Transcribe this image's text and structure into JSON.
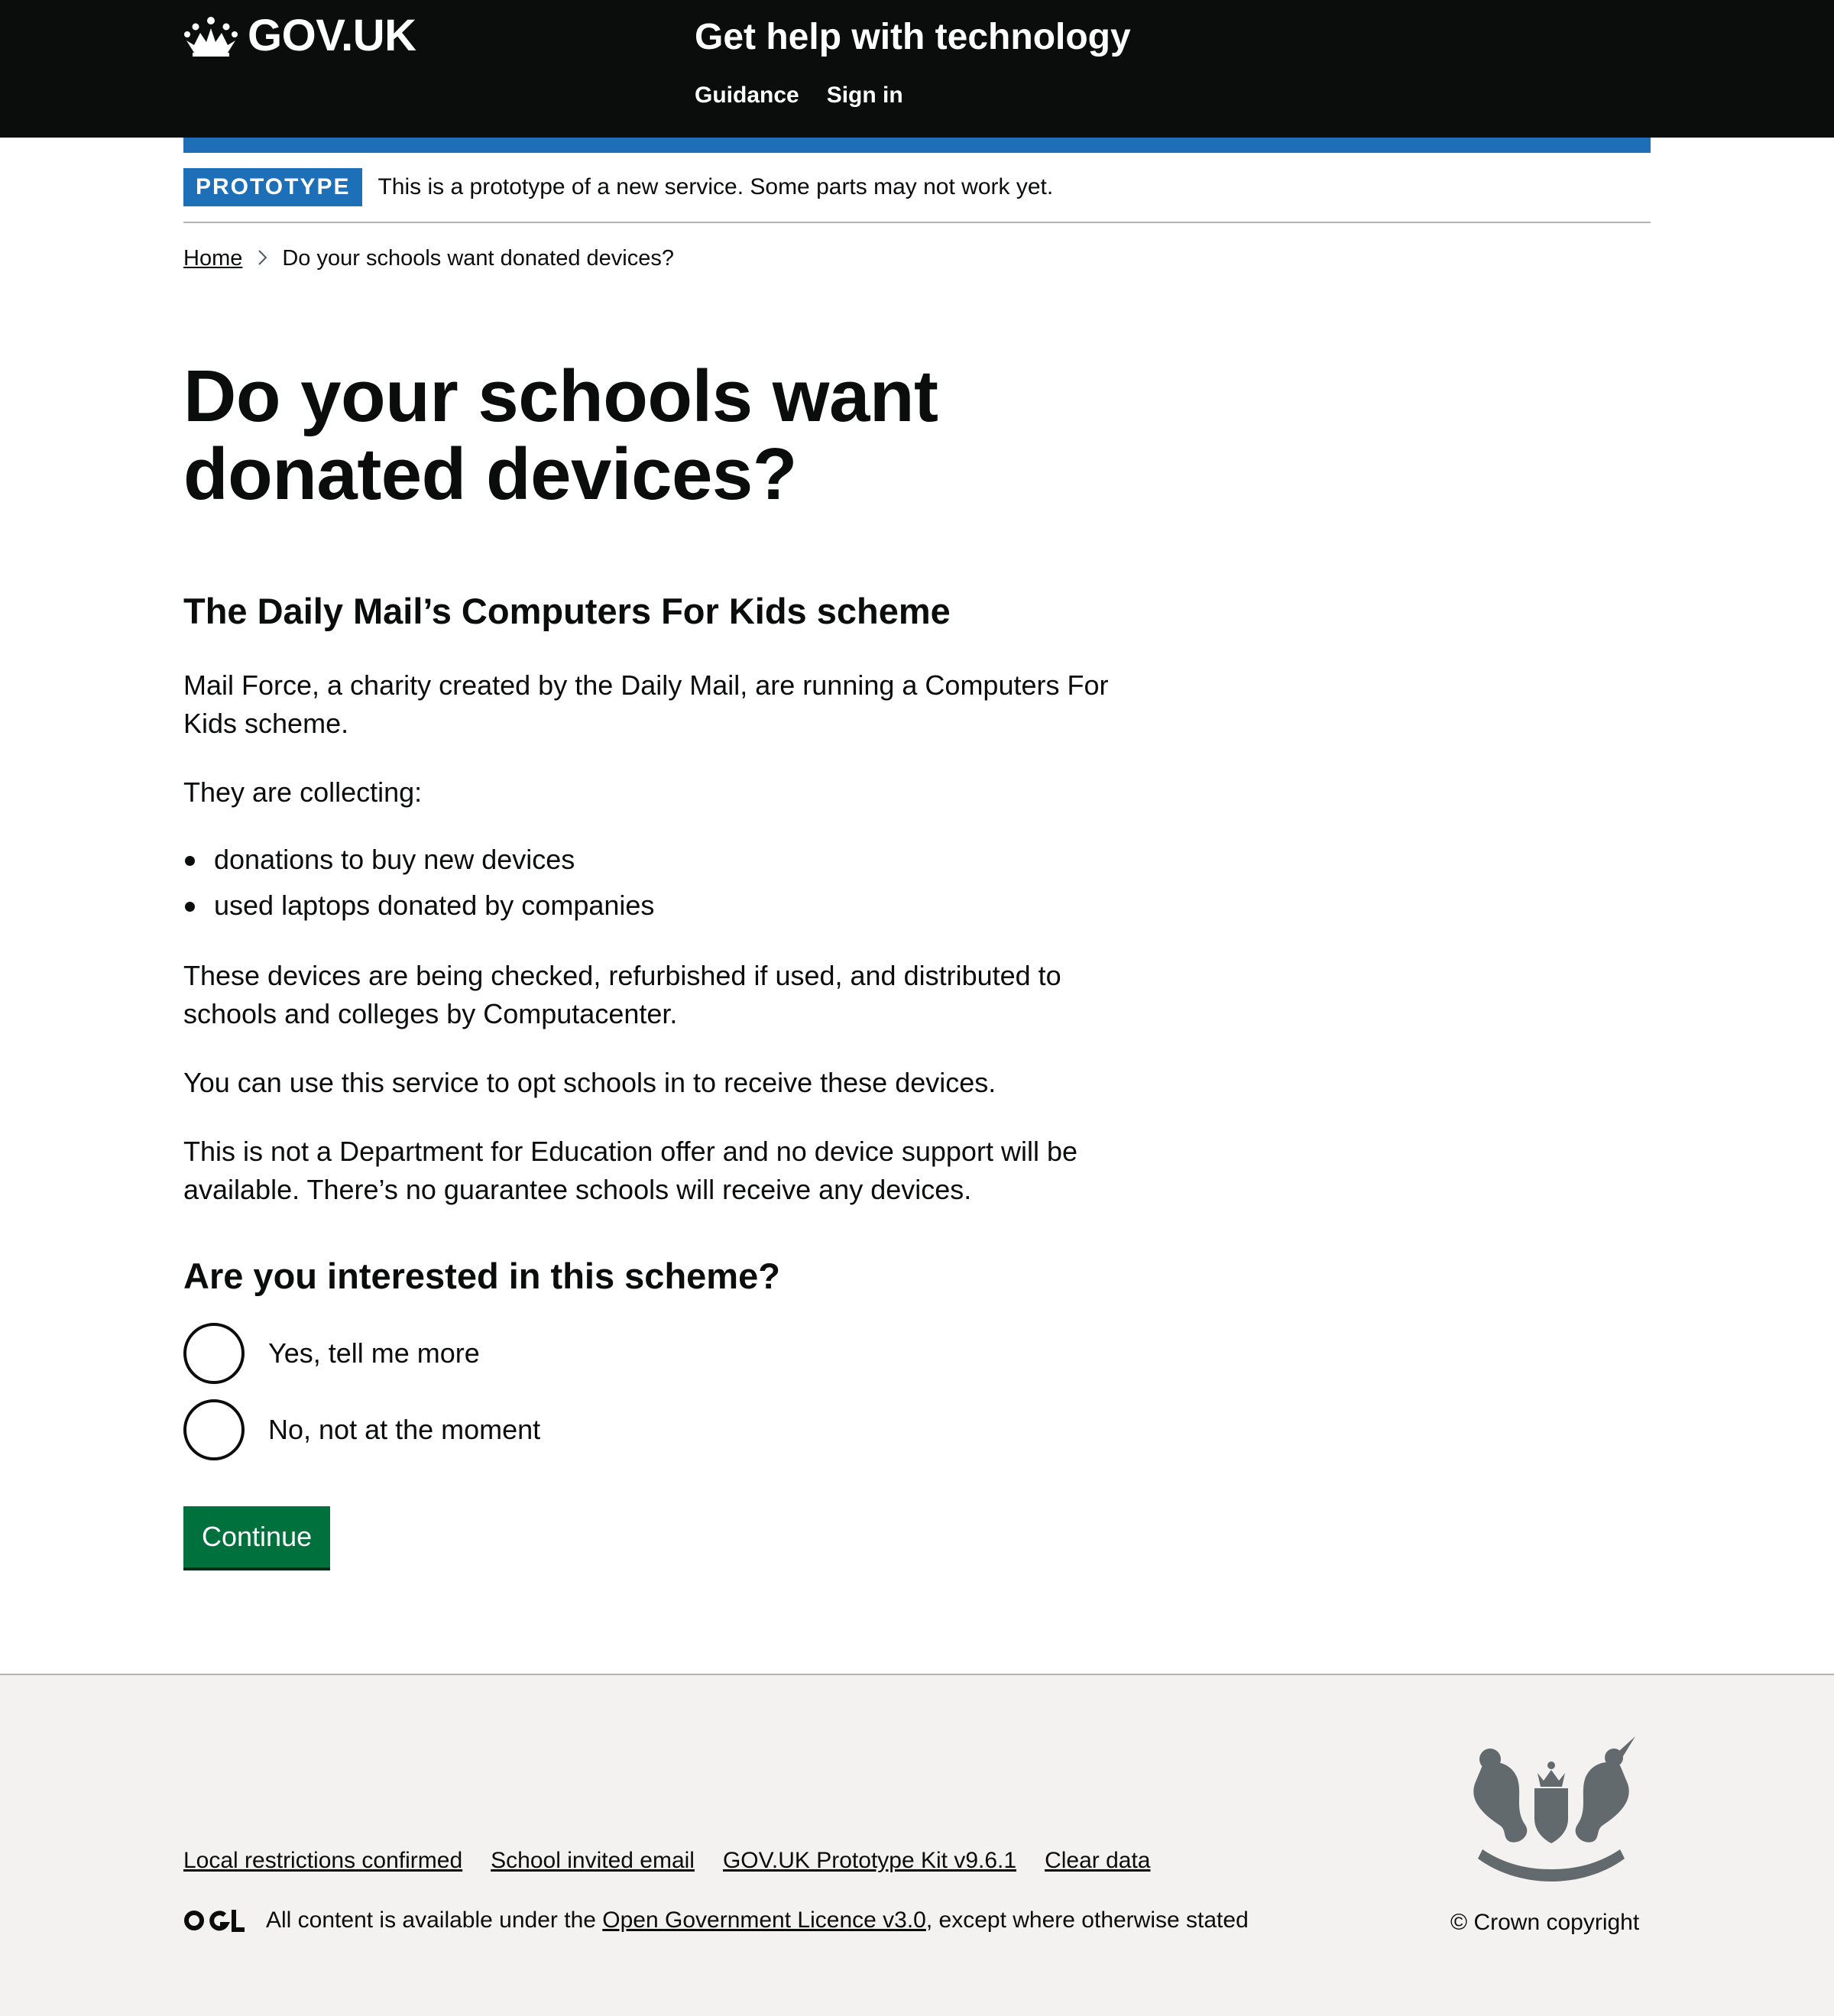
{
  "header": {
    "logo_text": "GOV.UK",
    "service_name": "Get help with technology",
    "nav": [
      {
        "label": "Guidance"
      },
      {
        "label": "Sign in"
      }
    ]
  },
  "phase_banner": {
    "tag": "PROTOTYPE",
    "text": "This is a prototype of a new service. Some parts may not work yet."
  },
  "breadcrumb": {
    "home": "Home",
    "current": "Do your schools want donated devices?"
  },
  "main": {
    "title": "Do your schools want donated devices?",
    "subheading": "The Daily Mail’s Computers For Kids scheme",
    "para1": "Mail Force, a charity created by the Daily Mail, are running a Computers For Kids scheme.",
    "para2": "They are collecting:",
    "bullets": [
      "donations to buy new devices",
      "used laptops donated by companies"
    ],
    "para3": "These devices are being checked, refurbished if used, and distributed to schools and colleges by Computacenter.",
    "para4": "You can use this service to opt schools in to receive these devices.",
    "para5": "This is not a Department for Education offer and no device support will be available. There’s no guarantee schools will receive any devices.",
    "question": "Are you interested in this scheme?",
    "options": [
      {
        "label": "Yes, tell me more",
        "selected": false
      },
      {
        "label": "No, not at the moment",
        "selected": false
      }
    ],
    "continue_label": "Continue"
  },
  "footer": {
    "links": [
      "Local restrictions confirmed",
      "School invited email",
      "GOV.UK Prototype Kit v9.6.1",
      "Clear data"
    ],
    "licence_prefix": "All content is available under the ",
    "licence_link": "Open Government Licence v3.0",
    "licence_suffix": ", except where otherwise stated",
    "copyright": "© Crown copyright"
  },
  "colors": {
    "header_bg": "#0b0c0c",
    "brand_blue": "#1d70b8",
    "button_green": "#00703c",
    "footer_bg": "#f3f2f1"
  }
}
